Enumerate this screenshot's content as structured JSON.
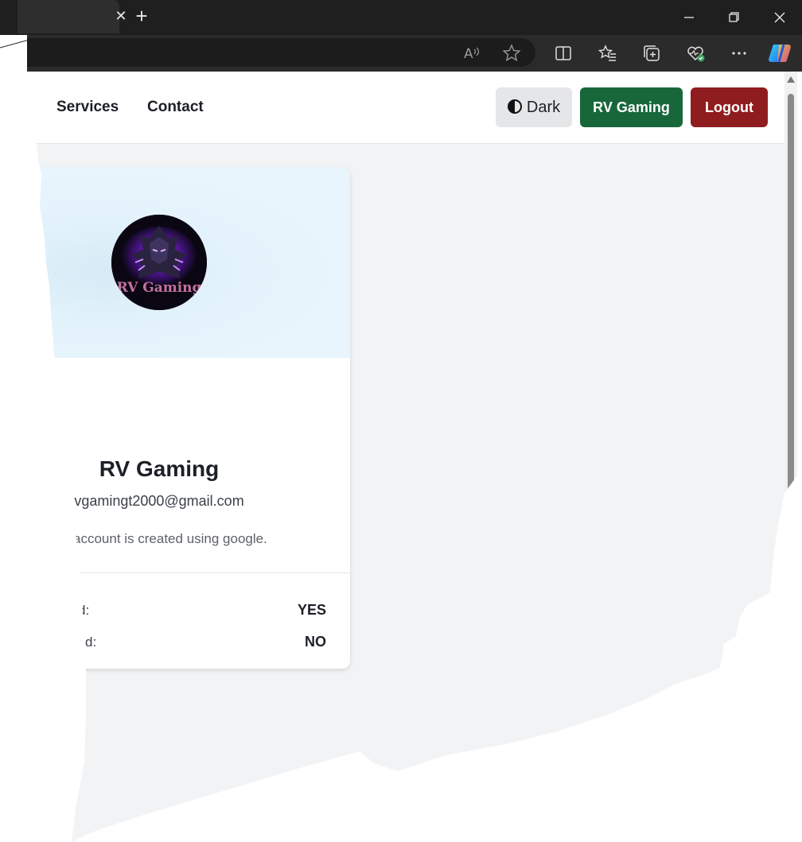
{
  "browser": {
    "tab_close_glyph": "✕",
    "new_tab_glyph": "+",
    "icons": [
      "read-aloud-icon",
      "favorite-star-icon",
      "split-screen-icon",
      "favorites-icon",
      "collections-icon",
      "browser-essentials-icon",
      "more-icon",
      "copilot-icon"
    ]
  },
  "nav": {
    "links": [
      "Services",
      "Contact"
    ],
    "theme_toggle_label": "Dark",
    "user_button_label": "RV Gaming",
    "logout_label": "Logout"
  },
  "profile": {
    "name": "RV Gaming",
    "email": "vgamingt2000@gmail.com",
    "note": "account is created using google.",
    "stats": [
      {
        "label": "d:",
        "value": "YES"
      },
      {
        "label": "d:",
        "value": "NO"
      }
    ],
    "avatar_text": "RV Gaming"
  },
  "colors": {
    "user_button": "#17673a",
    "logout_button": "#8f1c1f",
    "theme_button": "#e5e6e8",
    "page_bg": "#f2f3f5"
  }
}
